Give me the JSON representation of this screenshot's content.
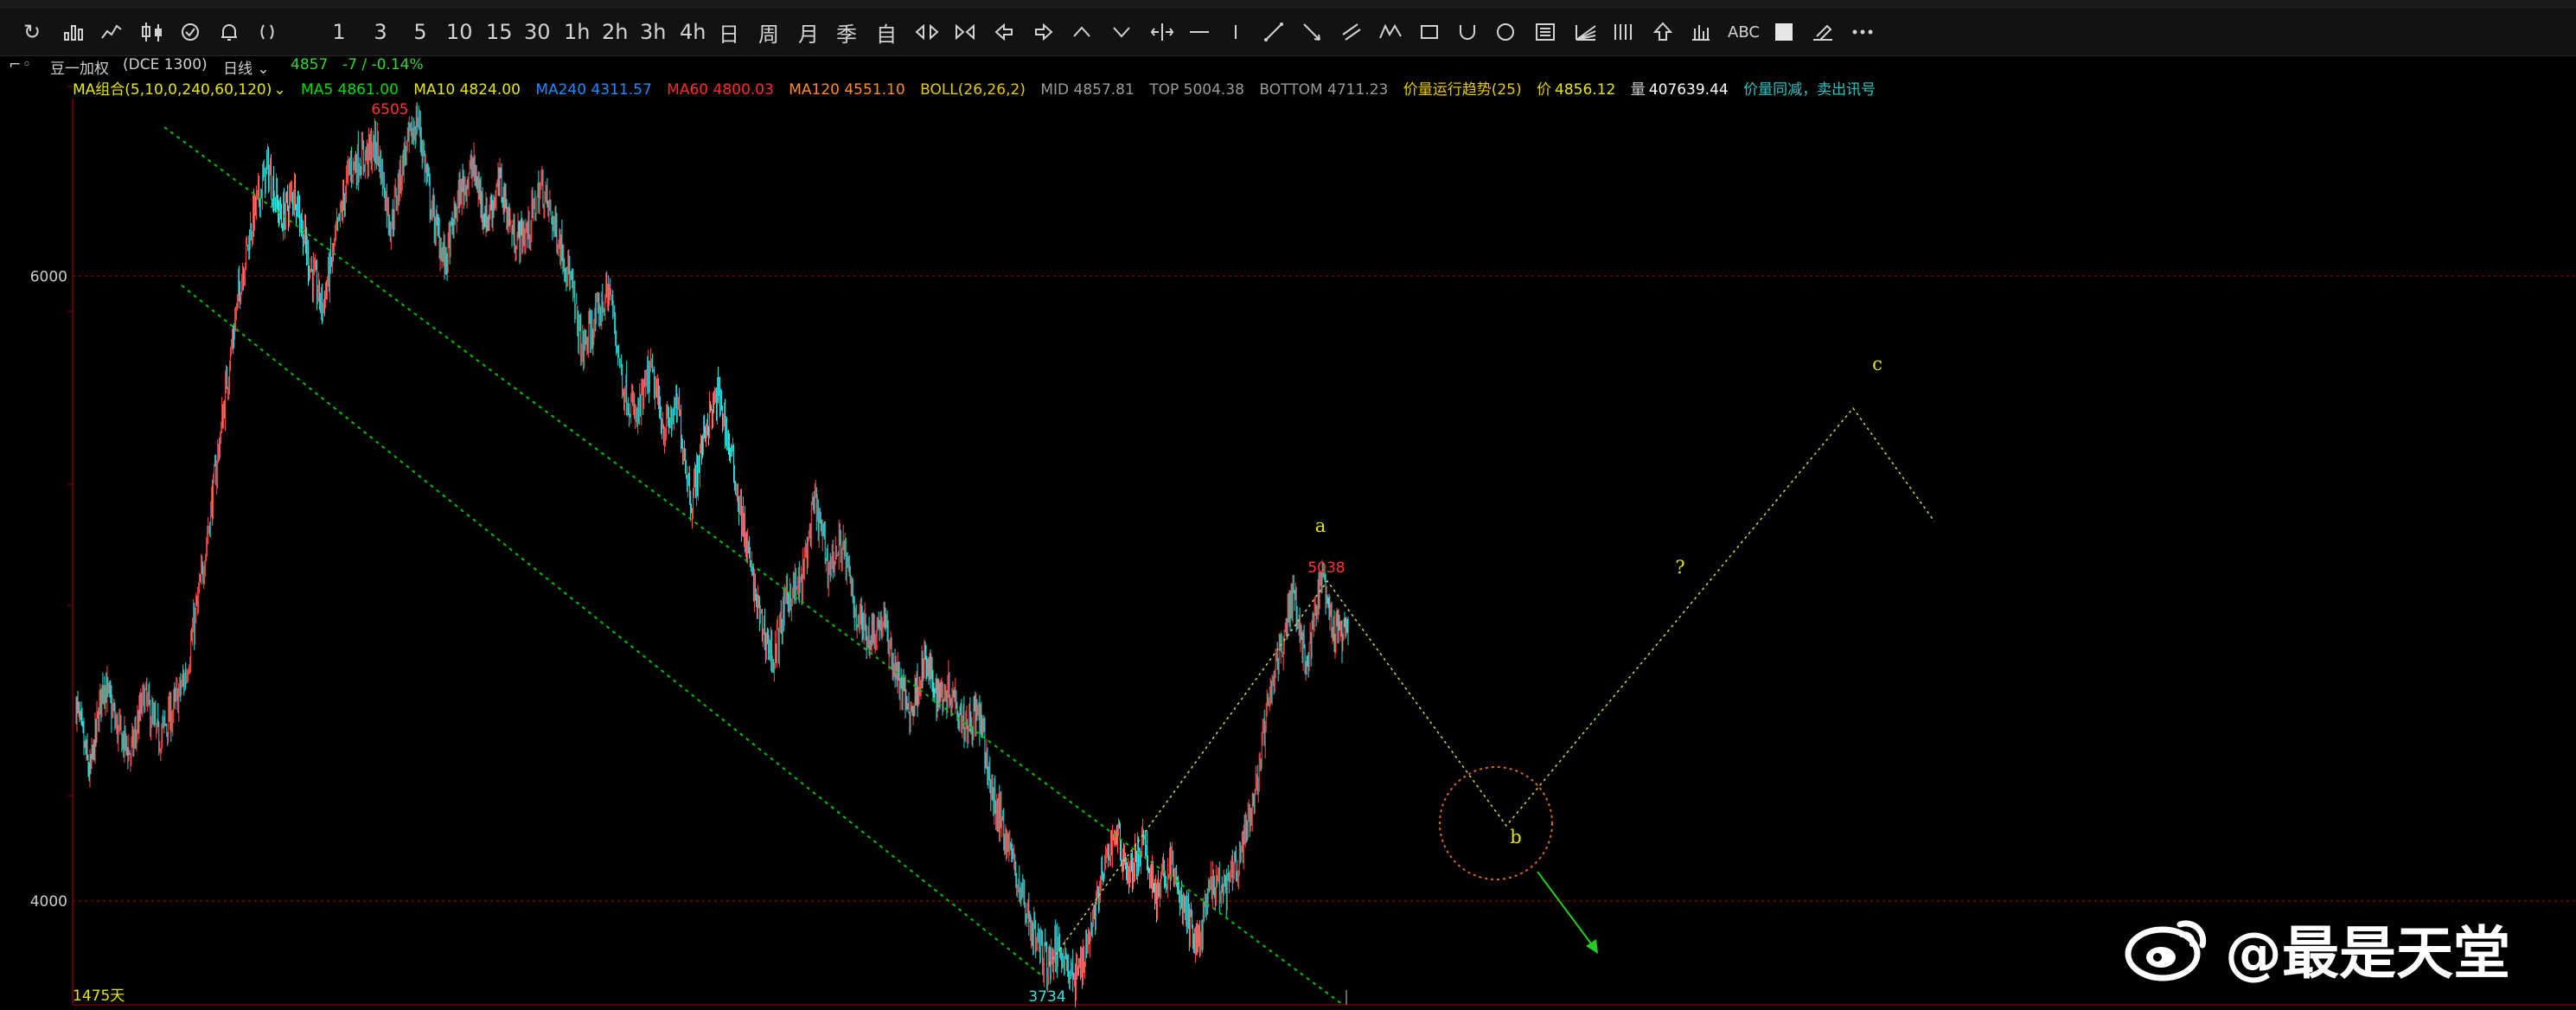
{
  "toolbar": {
    "items": [
      {
        "name": "refresh-icon",
        "glyph": "↻"
      },
      {
        "name": "period-1min-button",
        "glyph": "1"
      },
      {
        "name": "period-3min-button",
        "glyph": "3"
      },
      {
        "name": "period-5min-button",
        "glyph": "5"
      },
      {
        "name": "period-10min-button",
        "glyph": "10"
      },
      {
        "name": "period-15min-button",
        "glyph": "15"
      },
      {
        "name": "period-30min-button",
        "glyph": "30"
      },
      {
        "name": "period-1h-button",
        "glyph": "1h"
      },
      {
        "name": "period-2h-button",
        "glyph": "2h"
      },
      {
        "name": "period-3h-button",
        "glyph": "3h"
      },
      {
        "name": "period-4h-button",
        "glyph": "4h"
      },
      {
        "name": "period-day-button",
        "glyph": "日"
      },
      {
        "name": "period-week-button",
        "glyph": "周"
      },
      {
        "name": "period-month-button",
        "glyph": "月"
      },
      {
        "name": "period-season-button",
        "glyph": "季"
      },
      {
        "name": "period-custom-button",
        "glyph": "自"
      }
    ],
    "text_tool_label": "ABC"
  },
  "instrument": {
    "name": "豆一加权",
    "exchange": "DCE 1300",
    "period": "日线",
    "price": "4857",
    "change": "-7 / -0.14%"
  },
  "indicators": {
    "ma_group": "MA组合(5,10,0,240,60,120)",
    "ma5": "MA5 4861.00",
    "ma10": "MA10 4824.00",
    "ma240": "MA240 4311.57",
    "ma60": "MA60 4800.03",
    "ma120": "MA120 4551.10",
    "boll": "BOLL(26,26,2)",
    "mid": "MID 4857.81",
    "top": "TOP 5004.38",
    "bottom": "BOTTOM 4711.23",
    "trend": "价量运行趋势(25)",
    "price_label": "价",
    "price_value": "4856.12",
    "vol_label": "量",
    "vol_value": "407639.44",
    "signal": "价量同减，卖出讯号"
  },
  "colors": {
    "up": "#ff4d4d",
    "down": "#33e0e0",
    "channel": "#00c000",
    "projection": "#c8c850",
    "label_yellow": "#e6e600",
    "label_red": "#ff3333",
    "label_cyan": "#40e0e0",
    "gridline": "#7a0000"
  },
  "chart_data": {
    "type": "candlestick",
    "y_ticks": [
      4000,
      6000
    ],
    "ylim": [
      3630,
      6880
    ],
    "bars_label": "1475天",
    "annotations": {
      "high": "6505",
      "low": "3734",
      "recent_high": "5038",
      "wave_a": "a",
      "wave_b": "b",
      "wave_c": "c",
      "question": "?"
    },
    "key_prices": {
      "high": 6505,
      "low": 3734,
      "recent_high": 5038
    },
    "price_path": [
      4630,
      4400,
      4710,
      4550,
      4470,
      4660,
      4520,
      4600,
      4720,
      4980,
      5300,
      5650,
      5980,
      6200,
      6350,
      6180,
      6280,
      6050,
      5900,
      6120,
      6350,
      6380,
      6420,
      6160,
      6390,
      6505,
      6210,
      6040,
      6260,
      6350,
      6180,
      6300,
      6120,
      6140,
      6290,
      6160,
      6020,
      5760,
      5860,
      5960,
      5650,
      5540,
      5700,
      5510,
      5580,
      5270,
      5520,
      5620,
      5400,
      5140,
      4900,
      4770,
      4980,
      5010,
      5280,
      5070,
      5150,
      4920,
      4850,
      4900,
      4720,
      4600,
      4770,
      4660,
      4680,
      4570,
      4600,
      4330,
      4210,
      4040,
      3900,
      3800,
      3860,
      3734,
      3880,
      4070,
      4230,
      4080,
      4180,
      4020,
      4120,
      3970,
      3860,
      4050,
      4030,
      4130,
      4290,
      4580,
      4810,
      4990,
      4740,
      5038,
      4850,
      4860
    ]
  }
}
